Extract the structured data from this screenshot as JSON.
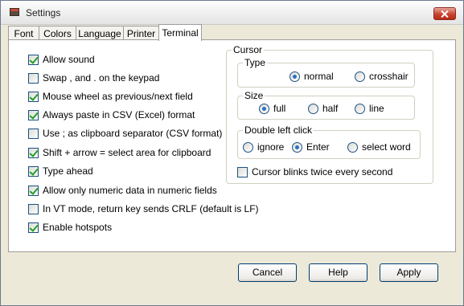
{
  "window": {
    "title": "Settings"
  },
  "tabs": [
    "Font",
    "Colors",
    "Language",
    "Printer",
    "Terminal"
  ],
  "options": [
    {
      "label": "Allow sound",
      "checked": true
    },
    {
      "label": "Swap , and . on the keypad",
      "checked": false
    },
    {
      "label": "Mouse wheel as previous/next field",
      "checked": true
    },
    {
      "label": "Always paste in CSV (Excel) format",
      "checked": true
    },
    {
      "label": "Use ; as clipboard separator (CSV format)",
      "checked": false
    },
    {
      "label": "Shift + arrow = select area for clipboard",
      "checked": true
    },
    {
      "label": "Type ahead",
      "checked": true
    },
    {
      "label": "Allow only numeric data in numeric fields",
      "checked": true
    },
    {
      "label": "In VT mode, return key sends CRLF (default is LF)",
      "checked": false
    },
    {
      "label": "Enable hotspots",
      "checked": true
    }
  ],
  "cursor": {
    "title": "Cursor",
    "type": {
      "title": "Type",
      "options": [
        "normal",
        "crosshair"
      ],
      "selected": "normal"
    },
    "size": {
      "title": "Size",
      "options": [
        "full",
        "half",
        "line"
      ],
      "selected": "full"
    },
    "double_click": {
      "title": "Double left click",
      "options": [
        "ignore",
        "Enter",
        "select word"
      ],
      "selected": "Enter"
    },
    "blink": {
      "label": "Cursor blinks twice every second",
      "checked": false
    }
  },
  "buttons": {
    "cancel": "Cancel",
    "help": "Help",
    "apply": "Apply"
  }
}
